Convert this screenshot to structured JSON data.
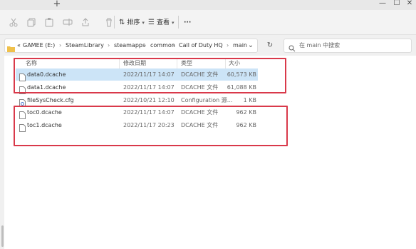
{
  "window": {
    "controls": {
      "minimize": "—",
      "maximize": "☐",
      "close": "✕"
    },
    "new_tab": "+"
  },
  "toolbar": {
    "sort_label": "排序",
    "view_label": "查看",
    "more_label": "···"
  },
  "address_bar": {
    "prefix": "«",
    "breadcrumbs": [
      "GAMEE (E:)",
      "SteamLibrary",
      "steamapps",
      "common",
      "Call of Duty HQ",
      "main"
    ],
    "separator": "›",
    "dropdown": "⌄",
    "refresh": "↻"
  },
  "search": {
    "placeholder": "在 main 中搜索"
  },
  "columns": {
    "name": "名称",
    "date": "修改日期",
    "type": "类型",
    "size": "大小"
  },
  "files": [
    {
      "name": "data0.dcache",
      "date": "2022/11/17 14:07",
      "type": "DCACHE 文件",
      "size": "60,573 KB",
      "selected": true
    },
    {
      "name": "data1.dcache",
      "date": "2022/11/17 14:07",
      "type": "DCACHE 文件",
      "size": "61,088 KB",
      "selected": false
    },
    {
      "name": "fileSysCheck.cfg",
      "date": "2022/10/21 12:10",
      "type": "Configuration 源...",
      "size": "1 KB",
      "selected": false
    },
    {
      "name": "toc0.dcache",
      "date": "2022/11/17 14:07",
      "type": "DCACHE 文件",
      "size": "962 KB",
      "selected": false
    },
    {
      "name": "toc1.dcache",
      "date": "2022/11/17 20:23",
      "type": "DCACHE 文件",
      "size": "962 KB",
      "selected": false
    }
  ],
  "colors": {
    "highlight": "#d9394a",
    "selection": "#cce4f7",
    "folder": "#f0c14b"
  }
}
